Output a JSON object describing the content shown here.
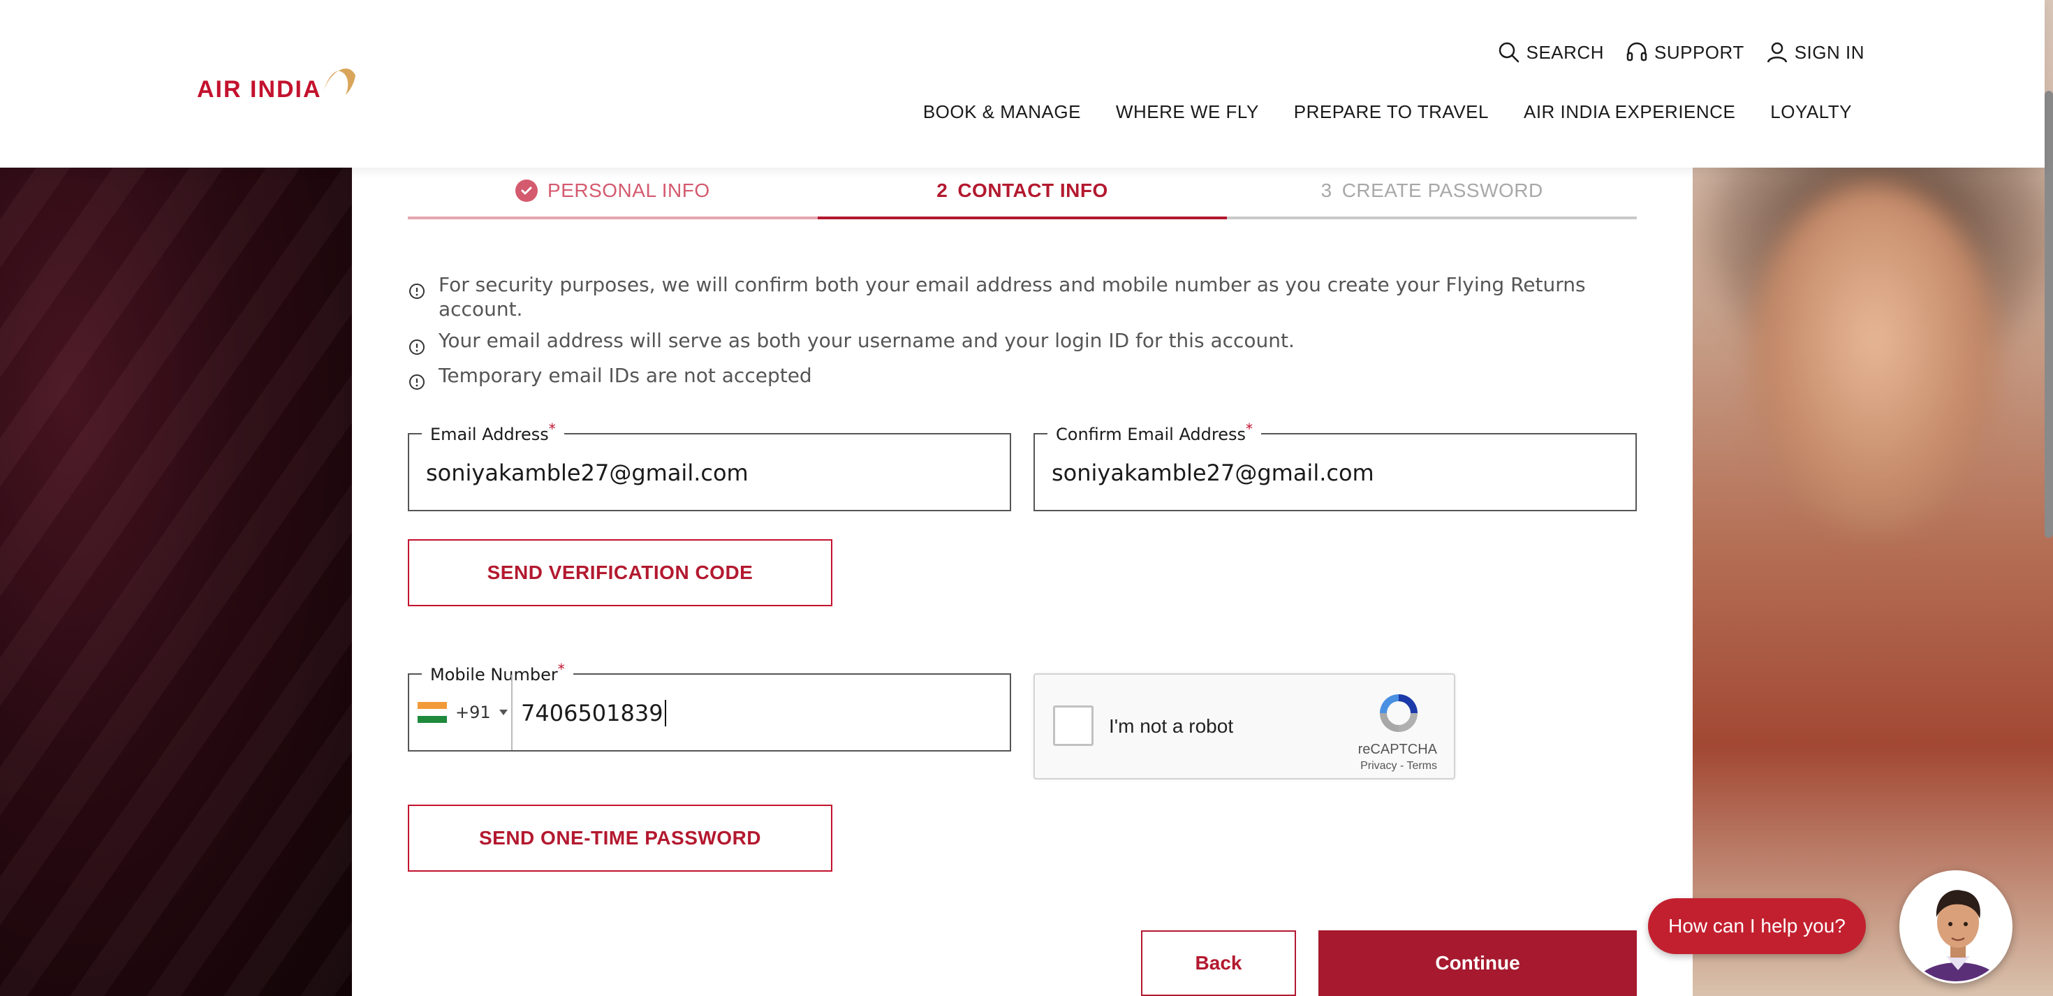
{
  "header": {
    "logo_text": "AIR INDIA",
    "util_nav": [
      {
        "label": "SEARCH",
        "icon": "search-icon"
      },
      {
        "label": "SUPPORT",
        "icon": "headset-icon"
      },
      {
        "label": "SIGN IN",
        "icon": "user-icon"
      }
    ],
    "main_nav": [
      "BOOK & MANAGE",
      "WHERE WE FLY",
      "PREPARE TO TRAVEL",
      "AIR INDIA EXPERIENCE",
      "LOYALTY"
    ]
  },
  "stepper": {
    "steps": [
      {
        "number": "",
        "label": "PERSONAL INFO",
        "state": "done"
      },
      {
        "number": "2",
        "label": "CONTACT INFO",
        "state": "active"
      },
      {
        "number": "3",
        "label": "CREATE PASSWORD",
        "state": "pending"
      }
    ]
  },
  "info": [
    "For security purposes, we will confirm both your email address and mobile number as you create your Flying Returns account.",
    "Your email address will serve as both your username and your login ID for this account.",
    "Temporary email IDs are not accepted"
  ],
  "form": {
    "email_label": "Email Address",
    "email_value": "soniyakamble27@gmail.com",
    "confirm_email_label": "Confirm Email Address",
    "confirm_email_value": "soniyakamble27@gmail.com",
    "required_mark": "*",
    "send_code_label": "SEND VERIFICATION CODE",
    "mobile_label": "Mobile Number",
    "country_code": "+91",
    "mobile_value": "7406501839",
    "send_otp_label": "SEND ONE-TIME PASSWORD"
  },
  "recaptcha": {
    "label": "I'm not a robot",
    "brand": "reCAPTCHA",
    "terms": "Privacy - Terms"
  },
  "actions": {
    "back_label": "Back",
    "continue_label": "Continue"
  },
  "chat": {
    "bubble_text": "How can I help you?"
  },
  "colors": {
    "brand_red": "#c3122e",
    "continue_bg": "#a6192e"
  }
}
